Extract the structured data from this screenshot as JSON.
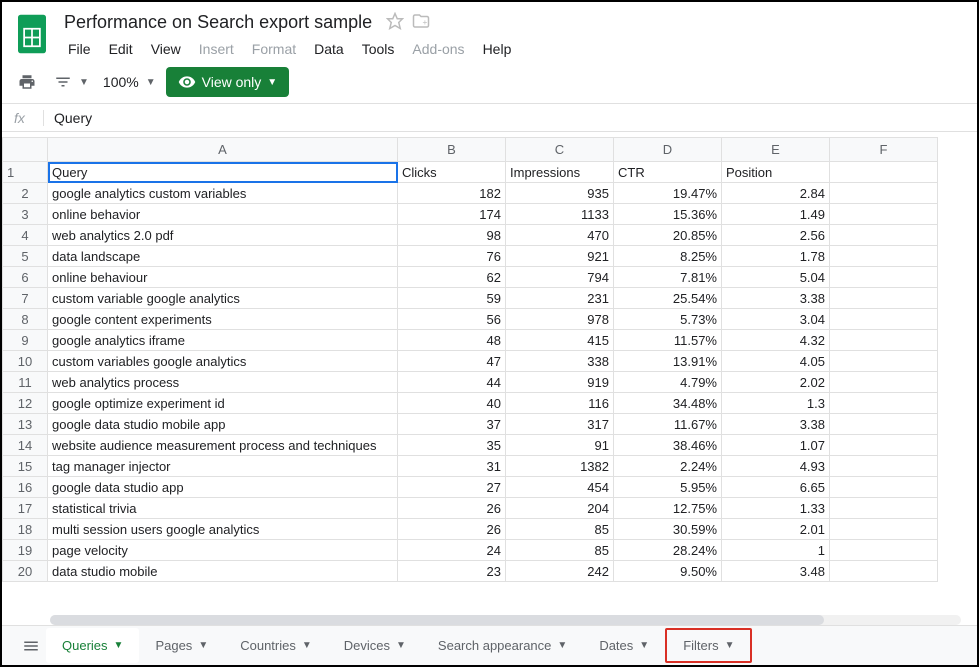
{
  "doc_title": "Performance on Search export sample",
  "menu": [
    "File",
    "Edit",
    "View",
    "Insert",
    "Format",
    "Data",
    "Tools",
    "Add-ons",
    "Help"
  ],
  "menu_disabled": [
    3,
    4,
    7
  ],
  "zoom": "100%",
  "view_only": "View only",
  "formula_value": "Query",
  "columns": [
    "A",
    "B",
    "C",
    "D",
    "E",
    "F"
  ],
  "header_row": [
    "Query",
    "Clicks",
    "Impressions",
    "CTR",
    "Position",
    ""
  ],
  "rows": [
    [
      "google analytics custom variables",
      "182",
      "935",
      "19.47%",
      "2.84",
      ""
    ],
    [
      "online behavior",
      "174",
      "1133",
      "15.36%",
      "1.49",
      ""
    ],
    [
      "web analytics 2.0 pdf",
      "98",
      "470",
      "20.85%",
      "2.56",
      ""
    ],
    [
      "data landscape",
      "76",
      "921",
      "8.25%",
      "1.78",
      ""
    ],
    [
      "online behaviour",
      "62",
      "794",
      "7.81%",
      "5.04",
      ""
    ],
    [
      "custom variable google analytics",
      "59",
      "231",
      "25.54%",
      "3.38",
      ""
    ],
    [
      "google content experiments",
      "56",
      "978",
      "5.73%",
      "3.04",
      ""
    ],
    [
      "google analytics iframe",
      "48",
      "415",
      "11.57%",
      "4.32",
      ""
    ],
    [
      "custom variables google analytics",
      "47",
      "338",
      "13.91%",
      "4.05",
      ""
    ],
    [
      "web analytics process",
      "44",
      "919",
      "4.79%",
      "2.02",
      ""
    ],
    [
      "google optimize experiment id",
      "40",
      "116",
      "34.48%",
      "1.3",
      ""
    ],
    [
      "google data studio mobile app",
      "37",
      "317",
      "11.67%",
      "3.38",
      ""
    ],
    [
      "website audience measurement process and techniques",
      "35",
      "91",
      "38.46%",
      "1.07",
      ""
    ],
    [
      "tag manager injector",
      "31",
      "1382",
      "2.24%",
      "4.93",
      ""
    ],
    [
      "google data studio app",
      "27",
      "454",
      "5.95%",
      "6.65",
      ""
    ],
    [
      "statistical trivia",
      "26",
      "204",
      "12.75%",
      "1.33",
      ""
    ],
    [
      "multi session users google analytics",
      "26",
      "85",
      "30.59%",
      "2.01",
      ""
    ],
    [
      "page velocity",
      "24",
      "85",
      "28.24%",
      "1",
      ""
    ],
    [
      "data studio mobile",
      "23",
      "242",
      "9.50%",
      "3.48",
      ""
    ]
  ],
  "sheet_tabs": [
    "Queries",
    "Pages",
    "Countries",
    "Devices",
    "Search appearance",
    "Dates",
    "Filters"
  ],
  "active_tab": 0,
  "highlighted_tab": 6
}
